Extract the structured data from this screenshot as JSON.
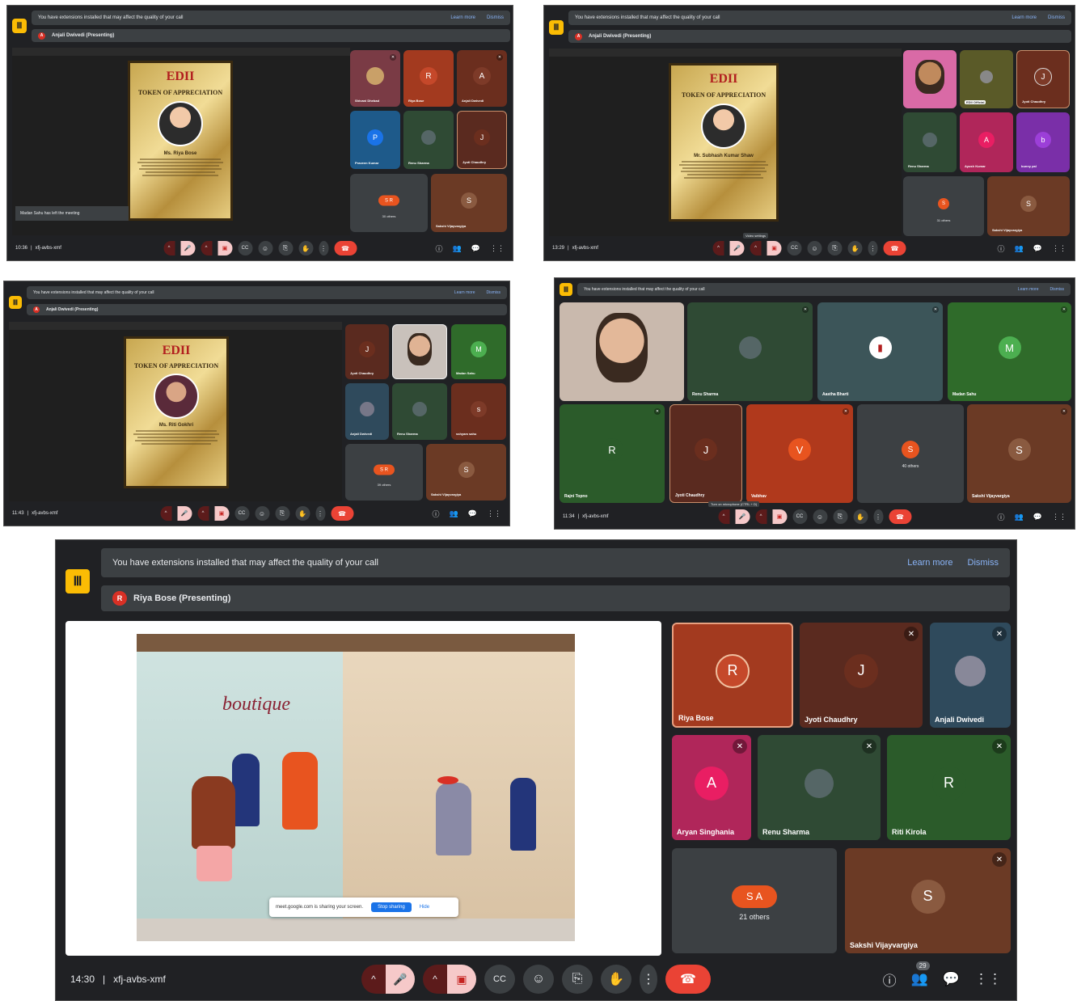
{
  "common": {
    "warning": "You have extensions installed that may affect the quality of your call",
    "learn_more": "Learn more",
    "dismiss": "Dismiss",
    "meeting_code": "xfj-avbs-xmf",
    "others_label_suffix": "others"
  },
  "shot1": {
    "presenter": "Anjali Dwivedi (Presenting)",
    "time": "10:36",
    "notice": "Madan Sahu has left the meeting",
    "certificate": {
      "logo": "EDII",
      "title": "TOKEN OF APPRECIATION",
      "name": "Ms. Riya Bose"
    },
    "tiles": [
      {
        "name": "Shivani Dhebad",
        "initial": "",
        "color": "#7a3b45"
      },
      {
        "name": "Riya Bose",
        "initial": "R",
        "color": "#a33a1f"
      },
      {
        "name": "Anjali Dwivedi",
        "initial": "A",
        "color": "#6b2e1e"
      },
      {
        "name": "Praveen Kumar",
        "initial": "P",
        "color": "#1e5a8a"
      },
      {
        "name": "Renu Sharma",
        "initial": "",
        "color": "#2f4a34"
      },
      {
        "name": "Jyoti Chaudhry",
        "initial": "J",
        "color": "#5a2a1f"
      },
      {
        "name": "",
        "initial": "S R",
        "color": "#3c4043",
        "others": "30 others"
      },
      {
        "name": "Sakshi Vijayvargiya",
        "initial": "S",
        "color": "#6b3a25"
      }
    ]
  },
  "shot2": {
    "presenter": "Anjali Dwivedi (Presenting)",
    "time": "13:29",
    "tooltip": "Video settings",
    "certificate": {
      "logo": "EDII",
      "title": "TOKEN OF APPRECIATION",
      "name": "Mr. Subhash Kumar Shaw"
    },
    "tiles": [
      {
        "name": "",
        "initial": "",
        "color": "#d96aa6"
      },
      {
        "name": "EDII Official",
        "initial": "",
        "color": "#5a5a28"
      },
      {
        "name": "Jyoti Chaudhry",
        "initial": "J",
        "color": "#6b2e1e"
      },
      {
        "name": "Renu Sharma",
        "initial": "",
        "color": "#2f4a34"
      },
      {
        "name": "Ayush Kumar",
        "initial": "A",
        "color": "#b0265a"
      },
      {
        "name": "bunny pal",
        "initial": "b",
        "color": "#7a2fa8"
      },
      {
        "name": "",
        "initial": "S",
        "color": "#3c4043",
        "others": "31 others"
      },
      {
        "name": "Sakshi Vijayvargiya",
        "initial": "S",
        "color": "#6b3a25"
      }
    ]
  },
  "shot3": {
    "presenter": "Anjali Dwivedi (Presenting)",
    "time": "11:43",
    "certificate": {
      "logo": "EDII",
      "title": "TOKEN OF APPRECIATION",
      "name": "Ms. Riti Gokhri"
    },
    "tiles": [
      {
        "name": "Jyoti Chaudhry",
        "initial": "J",
        "color": "#5a2a1f"
      },
      {
        "name": "",
        "initial": "",
        "color": "#c9c1bb"
      },
      {
        "name": "Madan Sahu",
        "initial": "M",
        "color": "#2f6b2a"
      },
      {
        "name": "Anjali Dwivedi",
        "initial": "",
        "color": "#2f4a5c"
      },
      {
        "name": "Renu Sharma",
        "initial": "",
        "color": "#2f4a34"
      },
      {
        "name": "sshyam sahu",
        "initial": "s",
        "color": "#6b2e1e"
      },
      {
        "name": "",
        "initial": "S R",
        "color": "#3c4043",
        "others": "39 others"
      },
      {
        "name": "Sakshi Vijayvargiya",
        "initial": "S",
        "color": "#6b3a25"
      }
    ]
  },
  "shot4": {
    "time": "11:34",
    "tooltip": "Turn on microphone (CTRL + D)",
    "others": "40 others",
    "tiles": [
      {
        "name": "",
        "initial": "",
        "color": "#c9b9ad"
      },
      {
        "name": "Renu Sharma",
        "initial": "",
        "color": "#2f4a34"
      },
      {
        "name": "Aastha Bharti",
        "initial": "",
        "color": "#3c5559"
      },
      {
        "name": "Madan Sahu",
        "initial": "M",
        "color": "#2f6b2a"
      },
      {
        "name": "Rajni Topno",
        "initial": "R",
        "color": "#2b5b2a"
      },
      {
        "name": "Jyoti Chaudhry",
        "initial": "J",
        "color": "#5a2a1f"
      },
      {
        "name": "Vaibhav",
        "initial": "V",
        "color": "#b0391c"
      },
      {
        "name": "",
        "initial": "S",
        "color": "#3c4043",
        "others": "40 others"
      },
      {
        "name": "Sakshi Vijayvargiya",
        "initial": "S",
        "color": "#6b3a25"
      }
    ]
  },
  "shot5": {
    "presenter": "Riya Bose (Presenting)",
    "presenter_initial": "R",
    "time": "14:30",
    "people_count": "29",
    "slide": {
      "sign": "boutique",
      "toast_text": "meet.google.com is sharing your screen.",
      "stop": "Stop sharing",
      "hide": "Hide"
    },
    "tiles": [
      {
        "name": "Riya Bose",
        "initial": "R",
        "color": "#a33a1f"
      },
      {
        "name": "Jyoti Chaudhry",
        "initial": "J",
        "color": "#5a2a1f"
      },
      {
        "name": "Anjali Dwivedi",
        "initial": "",
        "color": "#2f4a5c"
      },
      {
        "name": "Aryan Singhania",
        "initial": "A",
        "color": "#b0265a"
      },
      {
        "name": "Renu Sharma",
        "initial": "",
        "color": "#2f4a34"
      },
      {
        "name": "Riti Kirola",
        "initial": "R",
        "color": "#2b5b2a"
      },
      {
        "name": "",
        "initial": "S A",
        "color": "#3c4043",
        "others": "21 others"
      },
      {
        "name": "Sakshi Vijayvargiya",
        "initial": "S",
        "color": "#6b3a25"
      }
    ]
  }
}
